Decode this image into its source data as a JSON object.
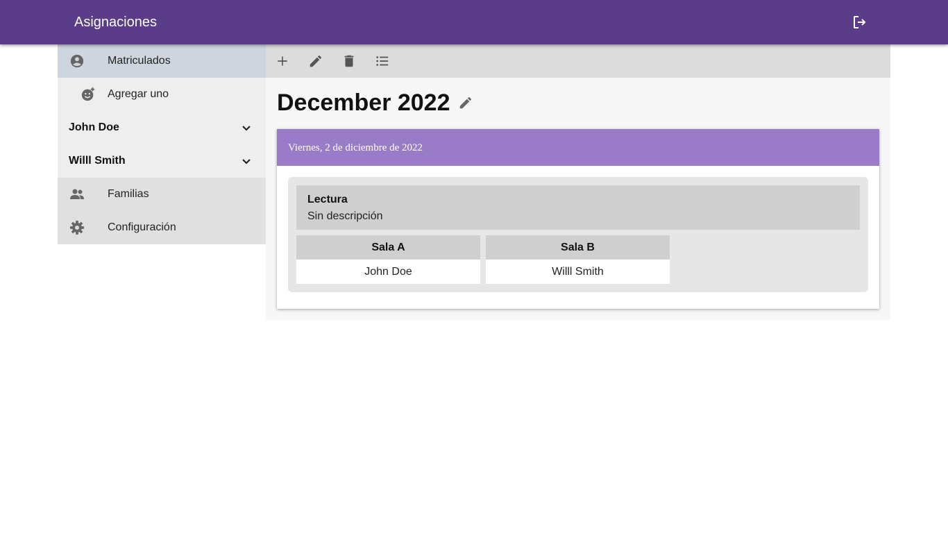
{
  "app": {
    "title": "Asignaciones",
    "logout_icon": "logout-icon"
  },
  "sidebar": {
    "items": [
      {
        "label": "Matriculados",
        "icon": "account-circle-icon"
      },
      {
        "label": "Agregar uno",
        "icon": "add-reaction-icon"
      },
      {
        "label": "John Doe",
        "icon": "chevron-down-icon"
      },
      {
        "label": "Willl Smith",
        "icon": "chevron-down-icon"
      },
      {
        "label": "Familias",
        "icon": "people-icon"
      },
      {
        "label": "Configuración",
        "icon": "gear-icon"
      }
    ]
  },
  "toolbar": {
    "icons": [
      "add-icon",
      "edit-icon",
      "delete-icon",
      "list-icon"
    ]
  },
  "main": {
    "title": "December 2022",
    "card": {
      "date": "Viernes, 2 de diciembre de 2022",
      "activity": {
        "title": "Lectura",
        "description": "Sin descripción"
      },
      "rooms": [
        {
          "name": "Sala A",
          "assignee": "John Doe"
        },
        {
          "name": "Sala B",
          "assignee": "Willl Smith"
        }
      ]
    }
  },
  "colors": {
    "primary": "#5b3c88",
    "card_header": "#9a7bc8",
    "active_item": "#cfd5de"
  }
}
